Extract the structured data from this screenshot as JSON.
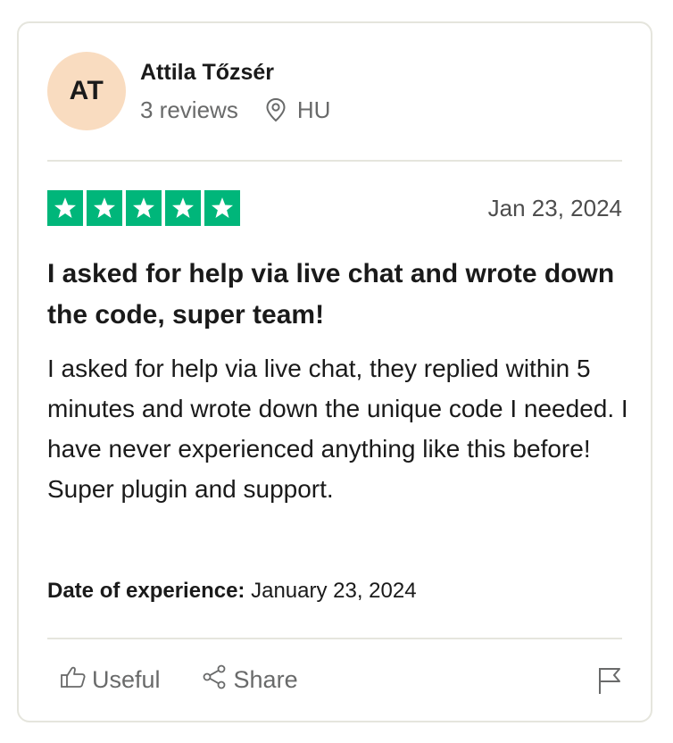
{
  "reviewer": {
    "initials": "AT",
    "name": "Attila Tőzsér",
    "reviews_count": "3 reviews",
    "country": "HU"
  },
  "rating": {
    "stars": 5,
    "max": 5
  },
  "review": {
    "date": "Jan 23, 2024",
    "title": "I asked for help via live chat and wrote down the code, super team!",
    "body": "I asked for help via live chat, they replied within 5 minutes and wrote down the unique code I needed. I have never experienced anything like this before! Super plugin and support.",
    "experience_label": "Date of experience:",
    "experience_date": "January 23, 2024"
  },
  "actions": {
    "useful": "Useful",
    "share": "Share"
  },
  "colors": {
    "star_green": "#00b67a",
    "avatar_bg": "#f9dcc0"
  },
  "icons": [
    "location-pin-icon",
    "star-icon",
    "thumbs-up-icon",
    "share-icon",
    "flag-icon"
  ]
}
